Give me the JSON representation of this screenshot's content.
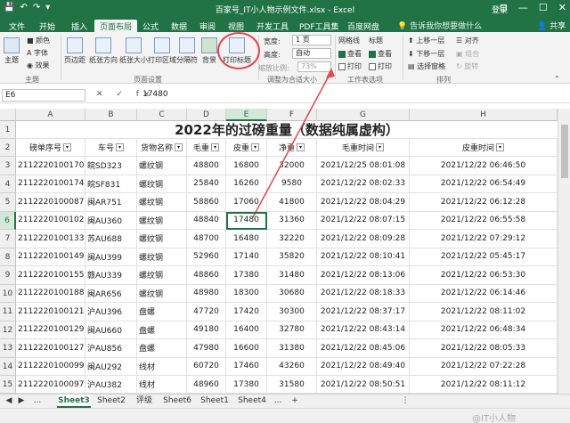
{
  "window": {
    "title": "百家号_IT小人物示例文件.xlsx - Excel",
    "login": "登录",
    "controls": [
      "⊡",
      "—",
      "☐",
      "✕"
    ]
  },
  "qat": [
    "💾",
    "↶",
    "↷",
    "▾"
  ],
  "tabs": [
    "文件",
    "开始",
    "插入",
    "页面布局",
    "公式",
    "数据",
    "审阅",
    "视图",
    "开发工具",
    "PDF工具集",
    "百度网盘"
  ],
  "active_tab": "页面布局",
  "search_placeholder": "告诉我你想要做什么",
  "share": "共享",
  "ribbon": {
    "theme": {
      "label": "主题",
      "items": [
        "颜色",
        "字体",
        "效果"
      ],
      "group": "主题"
    },
    "page_setup": {
      "buttons": [
        "页边距",
        "纸张方向",
        "纸张大小",
        "打印区域",
        "分隔符",
        "背景",
        "打印标题"
      ],
      "group": "页面设置"
    },
    "scale": {
      "width_label": "宽度:",
      "width_value": "1 页",
      "height_label": "高度:",
      "height_value": "自动",
      "scale_label": "缩放比例:",
      "scale_value": "73%",
      "group": "调整为合适大小"
    },
    "sheet_options": {
      "gridlines": "网格线",
      "headings": "标题",
      "view": "查看",
      "print": "打印",
      "group": "工作表选项"
    },
    "arrange": {
      "items": [
        "上移一层",
        "下移一层",
        "选择窗格",
        "对齐",
        "组合",
        "旋转"
      ],
      "group": "排列"
    }
  },
  "formula_bar": {
    "name_box": "E6",
    "fx": "✕ ✓ fx",
    "value": "17480"
  },
  "columns": [
    "A",
    "B",
    "C",
    "D",
    "E",
    "F",
    "G",
    "H",
    "I"
  ],
  "rows": [
    "1",
    "2",
    "3",
    "4",
    "5",
    "6",
    "7",
    "8",
    "9",
    "10",
    "11",
    "12",
    "13",
    "14",
    "15"
  ],
  "sheet_title": "2022年的过磅重量（数据纯属虚构）",
  "headers": [
    "磅单序号",
    "车号",
    "货物名称",
    "毛重",
    "皮重",
    "净重",
    "毛重时间",
    "皮重时间"
  ],
  "table": [
    [
      "2112220100170",
      "皖SD323",
      "螺纹钢",
      "48800",
      "16800",
      "32000",
      "2021/12/25 08:01:08",
      "2021/12/22 06:46:50"
    ],
    [
      "2112220100174",
      "皖SF831",
      "螺纹钢",
      "25840",
      "16260",
      "9580",
      "2021/12/22 08:02:33",
      "2021/12/22 06:54:49"
    ],
    [
      "2112220100087",
      "闽AR751",
      "螺纹钢",
      "58860",
      "17060",
      "41800",
      "2021/12/22 08:04:29",
      "2021/12/22 06:12:28"
    ],
    [
      "2112220100102",
      "闽AU360",
      "螺纹钢",
      "48840",
      "17480",
      "31360",
      "2021/12/22 08:07:15",
      "2021/12/22 06:55:58"
    ],
    [
      "2112220100133",
      "苏AU688",
      "螺纹钢",
      "48700",
      "16480",
      "32220",
      "2021/12/22 08:09:28",
      "2021/12/22 07:29:12"
    ],
    [
      "2112220100149",
      "闽AU399",
      "螺纹钢",
      "52960",
      "17140",
      "35820",
      "2021/12/22 08:10:41",
      "2021/12/22 05:45:17"
    ],
    [
      "2112220100155",
      "赣AU339",
      "螺纹钢",
      "48860",
      "17380",
      "31480",
      "2021/12/22 08:13:06",
      "2021/12/22 06:53:30"
    ],
    [
      "2112220100188",
      "闽AR656",
      "螺纹钢",
      "48980",
      "18300",
      "30680",
      "2021/12/22 08:18:33",
      "2021/12/22 06:14:46"
    ],
    [
      "2112220100121",
      "沪AU396",
      "盘螺",
      "47720",
      "17420",
      "30300",
      "2021/12/22 08:37:17",
      "2021/12/22 08:11:02"
    ],
    [
      "2112220100129",
      "闽AU660",
      "盘螺",
      "49180",
      "16400",
      "32780",
      "2021/12/22 08:43:14",
      "2021/12/22 06:48:34"
    ],
    [
      "2112220100127",
      "沪AU856",
      "盘螺",
      "47980",
      "16600",
      "31380",
      "2021/12/22 08:45:06",
      "2021/12/22 08:05:33"
    ],
    [
      "2112220100099",
      "闽AU292",
      "线材",
      "60720",
      "17460",
      "43260",
      "2021/12/22 08:49:40",
      "2021/12/22 07:22:28"
    ],
    [
      "2112220100097",
      "沪AU382",
      "线材",
      "48960",
      "17380",
      "31580",
      "2021/12/22 08:50:51",
      "2021/12/22 08:11:12"
    ]
  ],
  "sheet_tabs": [
    "Sheet3",
    "Sheet2",
    "评级",
    "Sheet6",
    "Sheet1",
    "Sheet4"
  ],
  "sheet_nav": [
    "◀",
    "▶",
    "...",
    "...",
    "+",
    "⋮"
  ],
  "active_sheet": "Sheet3",
  "watermark": "@IT小人物",
  "colors": {
    "accent": "#217346",
    "annotation": "#e0484e"
  }
}
